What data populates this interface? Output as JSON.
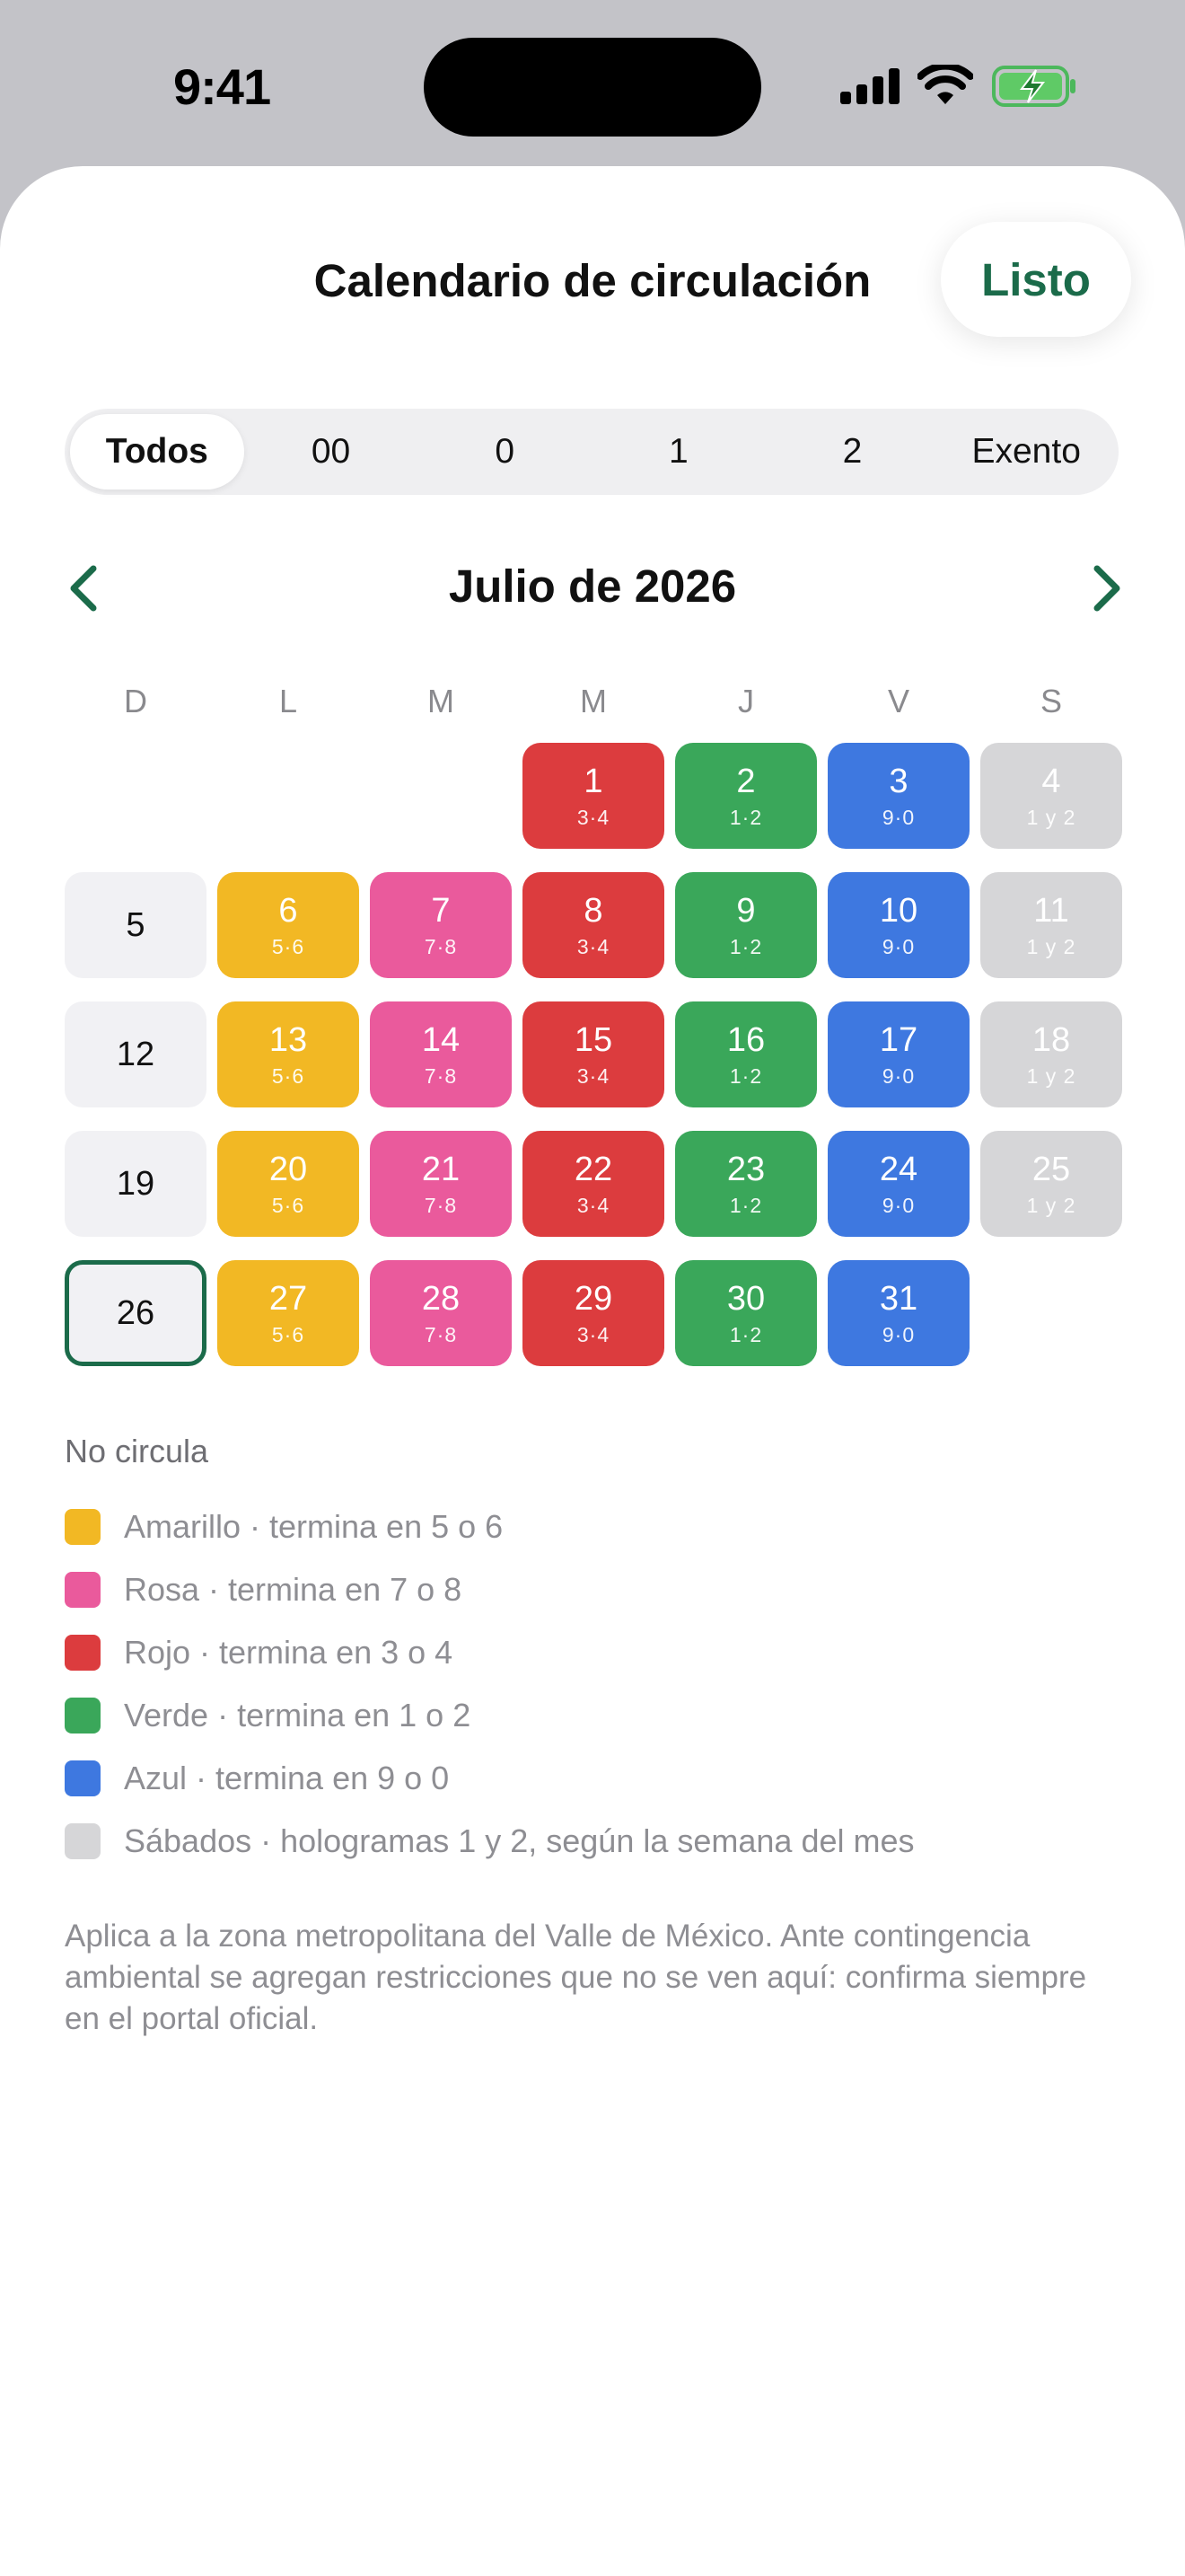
{
  "status": {
    "time": "9:41"
  },
  "header": {
    "title": "Calendario de circulación",
    "done_label": "Listo"
  },
  "filters": [
    {
      "label": "Todos",
      "active": true
    },
    {
      "label": "00",
      "active": false
    },
    {
      "label": "0",
      "active": false
    },
    {
      "label": "1",
      "active": false
    },
    {
      "label": "2",
      "active": false
    },
    {
      "label": "Exento",
      "active": false
    }
  ],
  "calendar": {
    "month_title": "Julio de 2026",
    "weekdays": [
      "D",
      "L",
      "M",
      "M",
      "J",
      "V",
      "S"
    ],
    "leading_blanks": 3,
    "days": [
      {
        "day": "1",
        "sub": "3·4",
        "color": "red"
      },
      {
        "day": "2",
        "sub": "1·2",
        "color": "green"
      },
      {
        "day": "3",
        "sub": "9·0",
        "color": "blue"
      },
      {
        "day": "4",
        "sub": "1 y 2",
        "color": "gray"
      },
      {
        "day": "5",
        "sub": "",
        "color": "plain"
      },
      {
        "day": "6",
        "sub": "5·6",
        "color": "yellow"
      },
      {
        "day": "7",
        "sub": "7·8",
        "color": "pink"
      },
      {
        "day": "8",
        "sub": "3·4",
        "color": "red"
      },
      {
        "day": "9",
        "sub": "1·2",
        "color": "green"
      },
      {
        "day": "10",
        "sub": "9·0",
        "color": "blue"
      },
      {
        "day": "11",
        "sub": "1 y 2",
        "color": "gray"
      },
      {
        "day": "12",
        "sub": "",
        "color": "plain"
      },
      {
        "day": "13",
        "sub": "5·6",
        "color": "yellow"
      },
      {
        "day": "14",
        "sub": "7·8",
        "color": "pink"
      },
      {
        "day": "15",
        "sub": "3·4",
        "color": "red"
      },
      {
        "day": "16",
        "sub": "1·2",
        "color": "green"
      },
      {
        "day": "17",
        "sub": "9·0",
        "color": "blue"
      },
      {
        "day": "18",
        "sub": "1 y 2",
        "color": "gray"
      },
      {
        "day": "19",
        "sub": "",
        "color": "plain"
      },
      {
        "day": "20",
        "sub": "5·6",
        "color": "yellow"
      },
      {
        "day": "21",
        "sub": "7·8",
        "color": "pink"
      },
      {
        "day": "22",
        "sub": "3·4",
        "color": "red"
      },
      {
        "day": "23",
        "sub": "1·2",
        "color": "green"
      },
      {
        "day": "24",
        "sub": "9·0",
        "color": "blue"
      },
      {
        "day": "25",
        "sub": "1 y 2",
        "color": "gray"
      },
      {
        "day": "26",
        "sub": "",
        "color": "today"
      },
      {
        "day": "27",
        "sub": "5·6",
        "color": "yellow"
      },
      {
        "day": "28",
        "sub": "7·8",
        "color": "pink"
      },
      {
        "day": "29",
        "sub": "3·4",
        "color": "red"
      },
      {
        "day": "30",
        "sub": "1·2",
        "color": "green"
      },
      {
        "day": "31",
        "sub": "9·0",
        "color": "blue"
      }
    ]
  },
  "legend": {
    "title": "No circula",
    "items": [
      {
        "label": "Amarillo · termina en 5 o 6",
        "color": "#f2b824"
      },
      {
        "label": "Rosa · termina en 7 o 8",
        "color": "#ea5a9c"
      },
      {
        "label": "Rojo · termina en 3 o 4",
        "color": "#dc3c3e"
      },
      {
        "label": "Verde · termina en 1 o 2",
        "color": "#3aa75a"
      },
      {
        "label": "Azul · termina en 9 o 0",
        "color": "#3e78e0"
      },
      {
        "label": "Sábados · hologramas 1 y 2, según la semana del mes",
        "color": "#d6d6d8"
      }
    ]
  },
  "note": "Aplica a la zona metropolitana del Valle de México. Ante contingencia ambiental se agregan restricciones que no se ven aquí: confirma siempre en el portal oficial."
}
